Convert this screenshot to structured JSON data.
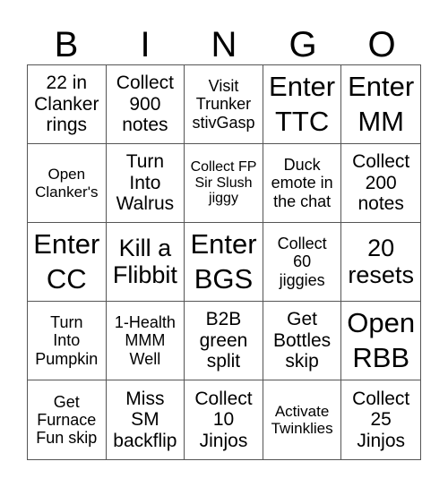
{
  "header": {
    "letters": [
      "B",
      "I",
      "N",
      "G",
      "O"
    ]
  },
  "cells": [
    {
      "text": "22 in\nClanker\nrings",
      "size": "s20"
    },
    {
      "text": "Collect\n900\nnotes",
      "size": "s20"
    },
    {
      "text": "Visit\nTrunker\nstivGasp",
      "size": "s18"
    },
    {
      "text": "Enter\nTTC",
      "size": "s30"
    },
    {
      "text": "Enter\nMM",
      "size": "s30"
    },
    {
      "text": "Open\nClanker's",
      "size": "s17"
    },
    {
      "text": "Turn\nInto\nWalrus",
      "size": "s20"
    },
    {
      "text": "Collect FP\nSir Slush\njiggy",
      "size": "s16"
    },
    {
      "text": "Duck\nemote in\nthe chat",
      "size": "s18"
    },
    {
      "text": "Collect\n200\nnotes",
      "size": "s20"
    },
    {
      "text": "Enter\nCC",
      "size": "s30"
    },
    {
      "text": "Kill a\nFlibbit",
      "size": "s26"
    },
    {
      "text": "Enter\nBGS",
      "size": "s30"
    },
    {
      "text": "Collect\n60\njiggies",
      "size": "s18"
    },
    {
      "text": "20\nresets",
      "size": "s26"
    },
    {
      "text": "Turn\nInto\nPumpkin",
      "size": "s18"
    },
    {
      "text": "1-Health\nMMM\nWell",
      "size": "s18"
    },
    {
      "text": "B2B\ngreen\nsplit",
      "size": "s20"
    },
    {
      "text": "Get\nBottles\nskip",
      "size": "s20"
    },
    {
      "text": "Open\nRBB",
      "size": "s30"
    },
    {
      "text": "Get\nFurnace\nFun skip",
      "size": "s18"
    },
    {
      "text": "Miss\nSM\nbackflip",
      "size": "s20"
    },
    {
      "text": "Collect\n10\nJinjos",
      "size": "s20"
    },
    {
      "text": "Activate\nTwinklies",
      "size": "s17"
    },
    {
      "text": "Collect\n25\nJinjos",
      "size": "s20"
    }
  ]
}
